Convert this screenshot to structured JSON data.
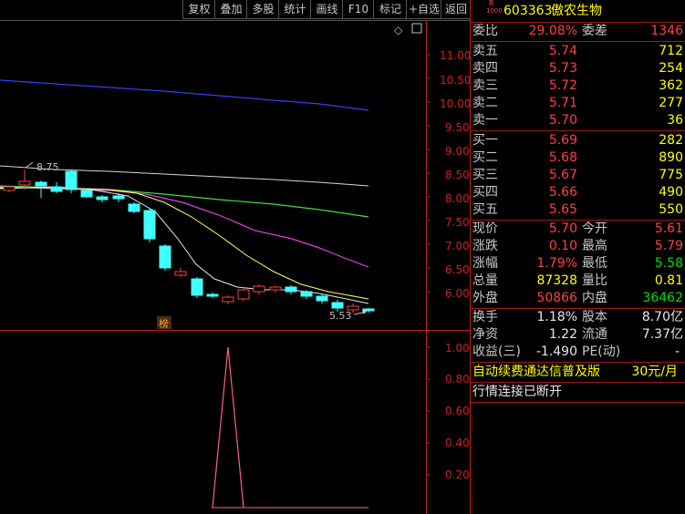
{
  "toolbar": {
    "buttons": [
      "复权",
      "叠加",
      "多股",
      "统计",
      "画线",
      "F10",
      "标记",
      "+自选",
      "返回"
    ]
  },
  "chart": {
    "main_axis_ticks": [
      "11.00",
      "10.50",
      "10.00",
      "9.50",
      "9.00",
      "8.50",
      "8.00",
      "7.50",
      "7.00",
      "6.50",
      "6.00"
    ],
    "sub_axis_ticks": [
      "1.00",
      "0.80",
      "0.60",
      "0.40",
      "0.20"
    ],
    "high_marker": "8.75",
    "low_marker": "5.53",
    "badge": "榜",
    "diamond": "◇",
    "colors": {
      "up": "#ff4040",
      "down": "#40ffff",
      "ma_white": "#e0e0e0",
      "ma_yellow": "#ffff40",
      "ma_magenta": "#e040e0",
      "ma_green": "#40e040",
      "ma_blue": "#3040ff",
      "indicator": "#ff6080",
      "axis": "#c02020"
    }
  },
  "quote": {
    "code_prefix_top": "R",
    "code_prefix_bottom": "1000",
    "code": "603363",
    "name": "傲农生物",
    "weibi_label": "委比",
    "weibi_value": "29.08%",
    "weicha_label": "委差",
    "weicha_value": "1346",
    "asks": [
      {
        "label": "卖五",
        "price": "5.74",
        "vol": "712"
      },
      {
        "label": "卖四",
        "price": "5.73",
        "vol": "254"
      },
      {
        "label": "卖三",
        "price": "5.72",
        "vol": "362"
      },
      {
        "label": "卖二",
        "price": "5.71",
        "vol": "277"
      },
      {
        "label": "卖一",
        "price": "5.70",
        "vol": "36"
      }
    ],
    "bids": [
      {
        "label": "买一",
        "price": "5.69",
        "vol": "282"
      },
      {
        "label": "买二",
        "price": "5.68",
        "vol": "890"
      },
      {
        "label": "买三",
        "price": "5.67",
        "vol": "775"
      },
      {
        "label": "买四",
        "price": "5.66",
        "vol": "490"
      },
      {
        "label": "买五",
        "price": "5.65",
        "vol": "550"
      }
    ],
    "stats": [
      {
        "l1": "现价",
        "v1": "5.70",
        "c1": "red",
        "l2": "今开",
        "v2": "5.61",
        "c2": "red"
      },
      {
        "l1": "涨跌",
        "v1": "0.10",
        "c1": "red",
        "l2": "最高",
        "v2": "5.79",
        "c2": "red"
      },
      {
        "l1": "涨幅",
        "v1": "1.79%",
        "c1": "red",
        "l2": "最低",
        "v2": "5.58",
        "c2": "green"
      },
      {
        "l1": "总量",
        "v1": "87328",
        "c1": "yellow",
        "l2": "量比",
        "v2": "0.81",
        "c2": "yellow"
      },
      {
        "l1": "外盘",
        "v1": "50866",
        "c1": "red",
        "l2": "内盘",
        "v2": "36462",
        "c2": "green"
      }
    ],
    "fundamentals": [
      {
        "l1": "换手",
        "v1": "1.18%",
        "l2": "股本",
        "v2": "8.70亿"
      },
      {
        "l1": "净资",
        "v1": "1.22",
        "l2": "流通",
        "v2": "7.37亿"
      },
      {
        "l1": "收益(三)",
        "v1": "-1.490",
        "l2": "PE(动)",
        "v2": "-"
      }
    ],
    "promo_text": "自动续费通达信普及版",
    "promo_price": "30元/月",
    "status": "行情连接已断开"
  }
}
